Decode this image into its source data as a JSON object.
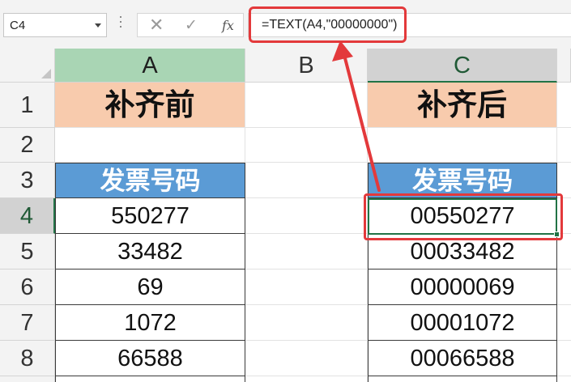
{
  "formula_bar": {
    "name_box": "C4",
    "cancel_icon": "✕",
    "enter_icon": "✓",
    "fx_label": "fx",
    "formula": "=TEXT(A4,\"00000000\")"
  },
  "columns": [
    "A",
    "B",
    "C"
  ],
  "rows": [
    "1",
    "2",
    "3",
    "4",
    "5",
    "6",
    "7",
    "8"
  ],
  "cells": {
    "a1": "补齐前",
    "c1": "补齐后",
    "a3": "发票号码",
    "c3": "发票号码",
    "a_values": [
      "550277",
      "33482",
      "69",
      "1072",
      "66588"
    ],
    "c_values": [
      "00550277",
      "00033482",
      "00000069",
      "00001072",
      "00066588"
    ]
  },
  "colors": {
    "title_fill": "#f8cbad",
    "header_fill": "#5b9bd5",
    "highlight_red": "#e3393b",
    "selection_green": "#217346"
  }
}
